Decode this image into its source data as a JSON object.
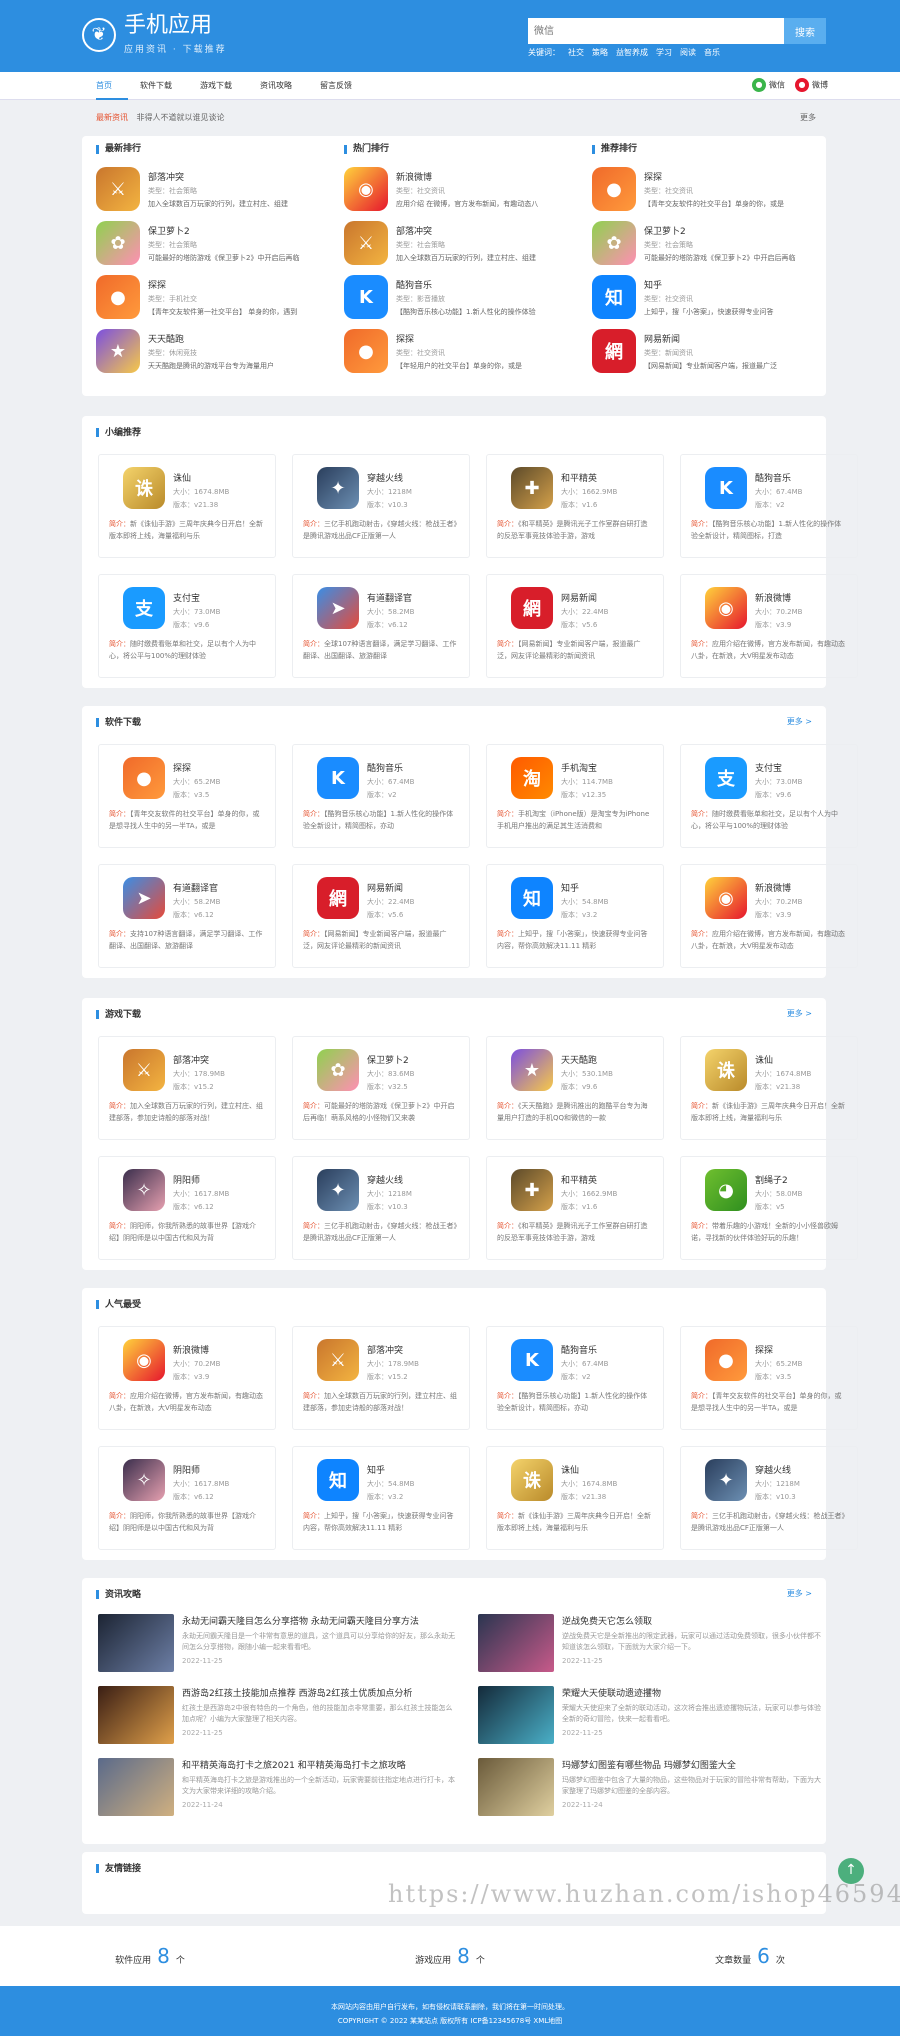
{
  "header": {
    "title": "手机应用",
    "subtitle": "应用资讯 · 下载推荐",
    "search_placeholder": "微信",
    "search_button": "搜索",
    "hot_label": "关键词：",
    "hot": [
      "社交",
      "策略",
      "益智养成",
      "学习",
      "阅读",
      "音乐"
    ]
  },
  "nav": {
    "items": [
      "首页",
      "软件下载",
      "游戏下载",
      "资讯攻略",
      "留言反馈"
    ],
    "wechat": "微信",
    "weibo": "微博"
  },
  "notice": {
    "label": "最新资讯",
    "text": "非得人不道就以谁见谈论",
    "more": "更多"
  },
  "rank": {
    "columns": [
      {
        "title": "最新排行",
        "items": [
          {
            "name": "部落冲突",
            "cat": "类型：社会策略",
            "desc": "加入全球数百万玩家的行列，建立村庄、组建"
          },
          {
            "name": "保卫萝卜2",
            "cat": "类型：社会策略",
            "desc": "可能最好的塔防游戏《保卫萝卜2》中开启后再临"
          },
          {
            "name": "探探",
            "cat": "类型：手机社交",
            "desc": "【青年交友软件第一社交平台】 单身的你，遇到"
          },
          {
            "name": "天天酷跑",
            "cat": "类型：休闲竞技",
            "desc": "天天酷跑是腾讯的游戏平台专为海量用户"
          }
        ]
      },
      {
        "title": "热门排行",
        "items": [
          {
            "name": "新浪微博",
            "cat": "类型：社交资讯",
            "desc": "应用介绍 在微博，官方发布新闻，有趣动态八"
          },
          {
            "name": "部落冲突",
            "cat": "类型：社会策略",
            "desc": "加入全球数百万玩家的行列，建立村庄、组建"
          },
          {
            "name": "酷狗音乐",
            "cat": "类型：影音播放",
            "desc": "【酷狗音乐核心功能】1.新人性化的操作体验"
          },
          {
            "name": "探探",
            "cat": "类型：社交资讯",
            "desc": "【年轻用户的社交平台】单身的你，或是"
          }
        ]
      },
      {
        "title": "推荐排行",
        "items": [
          {
            "name": "探探",
            "cat": "类型：社交资讯",
            "desc": "【青年交友软件的社交平台】单身的你，或是"
          },
          {
            "name": "保卫萝卜2",
            "cat": "类型：社会策略",
            "desc": "可能最好的塔防游戏《保卫萝卜2》中开启后再临"
          },
          {
            "name": "知乎",
            "cat": "类型：社交资讯",
            "desc": "上知乎，搜「小答案」，快速获得专业问答"
          },
          {
            "name": "网易新闻",
            "cat": "类型：新闻资讯",
            "desc": "【网易新闻】专业新闻客户端，报道最广泛"
          }
        ]
      }
    ]
  },
  "sections": [
    {
      "title": "小编推荐",
      "more": "",
      "cards": [
        {
          "name": "诛仙",
          "size": "大小：1674.8MB",
          "ver": "版本：v21.38",
          "desc": "新《诛仙手游》三周年庆典今日开启！全新版本即将上线，海量福利与乐"
        },
        {
          "name": "穿越火线",
          "size": "大小：1218M",
          "ver": "版本：v10.3",
          "desc": "三亿手机跑动射击，《穿越火线：枪战王者》是腾讯游戏出品CF正版第一人"
        },
        {
          "name": "和平精英",
          "size": "大小：1662.9MB",
          "ver": "版本：v1.6",
          "desc": "《和平精英》是腾讯光子工作室群自研打造的反恐军事竞技体验手游，游戏"
        },
        {
          "name": "酷狗音乐",
          "size": "大小：67.4MB",
          "ver": "版本：v2",
          "desc": "【酷狗音乐核心功能】1.新人性化的操作体验全新设计，精简图标，打造"
        },
        {
          "name": "支付宝",
          "size": "大小：73.0MB",
          "ver": "版本：v9.6",
          "desc": "随时缴费看账单和社交，足以有个人为中心，将公平与100%的理财体验"
        },
        {
          "name": "有道翻译官",
          "size": "大小：58.2MB",
          "ver": "版本：v6.12",
          "desc": "全球107种语言翻译，满足学习翻译、工作翻译、出国翻译、旅游翻译"
        },
        {
          "name": "网易新闻",
          "size": "大小：22.4MB",
          "ver": "版本：v5.6",
          "desc": "【网易新闻】专业新闻客户端，报道最广泛，网友评论最精彩的新闻资讯"
        },
        {
          "name": "新浪微博",
          "size": "大小：70.2MB",
          "ver": "版本：v3.9",
          "desc": "应用介绍在微博，官方发布新闻，有趣动态八卦，在新浪，大V明星发布动态"
        }
      ]
    },
    {
      "title": "软件下载",
      "more": "更多 >",
      "cards": [
        {
          "name": "探探",
          "size": "大小：65.2MB",
          "ver": "版本：v3.5",
          "desc": "【青年交友软件的社交平台】单身的你，或是想寻找人生中的另一半TA，或是"
        },
        {
          "name": "酷狗音乐",
          "size": "大小：67.4MB",
          "ver": "版本：v2",
          "desc": "【酷狗音乐核心功能】1.新人性化的操作体验全新设计，精简图标，亦动"
        },
        {
          "name": "手机淘宝",
          "size": "大小：114.7MB",
          "ver": "版本：v12.35",
          "desc": "手机淘宝（iPhone版）是淘宝专为iPhone手机用户推出的满足其生活消费和"
        },
        {
          "name": "支付宝",
          "size": "大小：73.0MB",
          "ver": "版本：v9.6",
          "desc": "随时缴费看账单和社交，足以有个人为中心，将公平与100%的理财体验"
        },
        {
          "name": "有道翻译官",
          "size": "大小：58.2MB",
          "ver": "版本：v6.12",
          "desc": "支持107种语言翻译，满足学习翻译、工作翻译、出国翻译、旅游翻译"
        },
        {
          "name": "网易新闻",
          "size": "大小：22.4MB",
          "ver": "版本：v5.6",
          "desc": "【网易新闻】专业新闻客户端，报道最广泛，网友评论最精彩的新闻资讯"
        },
        {
          "name": "知乎",
          "size": "大小：54.8MB",
          "ver": "版本：v3.2",
          "desc": "上知乎，搜「小答案」，快速获得专业问答内容，帮你高效解决11.11 精彩"
        },
        {
          "name": "新浪微博",
          "size": "大小：70.2MB",
          "ver": "版本：v3.9",
          "desc": "应用介绍在微博，官方发布新闻，有趣动态八卦，在新浪，大V明星发布动态"
        }
      ]
    },
    {
      "title": "游戏下载",
      "more": "更多 >",
      "cards": [
        {
          "name": "部落冲突",
          "size": "大小：178.9MB",
          "ver": "版本：v15.2",
          "desc": "加入全球数百万玩家的行列，建立村庄、组建部落，参加史诗般的部落对战！"
        },
        {
          "name": "保卫萝卜2",
          "size": "大小：83.6MB",
          "ver": "版本：v32.5",
          "desc": "可能最好的塔防游戏《保卫萝卜2》中开启后再临！萌系风格的小怪物们又来袭"
        },
        {
          "name": "天天酷跑",
          "size": "大小：530.1MB",
          "ver": "版本：v9.6",
          "desc": "《天天酷跑》是腾讯推出的跑酷平台专为海量用户打造的手机QQ和微信的一款"
        },
        {
          "name": "诛仙",
          "size": "大小：1674.8MB",
          "ver": "版本：v21.38",
          "desc": "新《诛仙手游》三周年庆典今日开启！全新版本即将上线，海量福利与乐"
        },
        {
          "name": "阴阳师",
          "size": "大小：1617.8MB",
          "ver": "版本：v6.12",
          "desc": "阴阳师，你我所熟悉的故事世界【游戏介绍】阴阳师是以中国古代和风为背"
        },
        {
          "name": "穿越火线",
          "size": "大小：1218M",
          "ver": "版本：v10.3",
          "desc": "三亿手机跑动射击，《穿越火线：枪战王者》是腾讯游戏出品CF正版第一人"
        },
        {
          "name": "和平精英",
          "size": "大小：1662.9MB",
          "ver": "版本：v1.6",
          "desc": "《和平精英》是腾讯光子工作室群自研打造的反恐军事竞技体验手游，游戏"
        },
        {
          "name": "割绳子2",
          "size": "大小：58.0MB",
          "ver": "版本：v5",
          "desc": "带着乐趣的小游戏！全新的小小怪兽欧姆诺，寻找新的伙伴体验好玩的乐趣！"
        }
      ]
    },
    {
      "title": "人气最受",
      "more": "",
      "cards": [
        {
          "name": "新浪微博",
          "size": "大小：70.2MB",
          "ver": "版本：v3.9",
          "desc": "应用介绍在微博，官方发布新闻，有趣动态八卦，在新浪，大V明星发布动态"
        },
        {
          "name": "部落冲突",
          "size": "大小：178.9MB",
          "ver": "版本：v15.2",
          "desc": "加入全球数百万玩家的行列，建立村庄、组建部落，参加史诗般的部落对战！"
        },
        {
          "name": "酷狗音乐",
          "size": "大小：67.4MB",
          "ver": "版本：v2",
          "desc": "【酷狗音乐核心功能】1.新人性化的操作体验全新设计，精简图标，亦动"
        },
        {
          "name": "探探",
          "size": "大小：65.2MB",
          "ver": "版本：v3.5",
          "desc": "【青年交友软件的社交平台】单身的你，或是想寻找人生中的另一半TA，或是"
        },
        {
          "name": "阴阳师",
          "size": "大小：1617.8MB",
          "ver": "版本：v6.12",
          "desc": "阴阳师，你我所熟悉的故事世界【游戏介绍】阴阳师是以中国古代和风为背"
        },
        {
          "name": "知乎",
          "size": "大小：54.8MB",
          "ver": "版本：v3.2",
          "desc": "上知乎，搜「小答案」，快速获得专业问答内容，帮你高效解决11.11 精彩"
        },
        {
          "name": "诛仙",
          "size": "大小：1674.8MB",
          "ver": "版本：v21.38",
          "desc": "新《诛仙手游》三周年庆典今日开启！全新版本即将上线，海量福利与乐"
        },
        {
          "name": "穿越火线",
          "size": "大小：1218M",
          "ver": "版本：v10.3",
          "desc": "三亿手机跑动射击，《穿越火线：枪战王者》是腾讯游戏出品CF正版第一人"
        }
      ]
    }
  ],
  "card_desc_label": "简介：",
  "news": {
    "title": "资讯攻略",
    "more": "更多 >",
    "items": [
      {
        "title": "永劫无间霸天隆目怎么分享搭物 永劫无间霸天隆目分享方法",
        "summary": "永劫无间霸天隆目是一个非常有意思的道具，这个道具可以分享给你的好友，那么永劫无间怎么分享搭物，跟随小编一起来看看吧。",
        "date": "2022-11-25"
      },
      {
        "title": "逆战免费天它怎么领取",
        "summary": "逆战免费天它是全新推出的限定武器，玩家可以通过活动免费领取，很多小伙伴都不知道该怎么领取，下面就为大家介绍一下。",
        "date": "2022-11-25"
      },
      {
        "title": "西游岛2红孩土技能加点推荐 西游岛2红孩土优质加点分析",
        "summary": "红孩土是西游岛2中很有特色的一个角色，他的技能加点非常重要，那么红孩土技能怎么加点呢？小编为大家整理了相关内容。",
        "date": "2022-11-25"
      },
      {
        "title": "荣耀大天使联动遗迹攫物",
        "summary": "荣耀大天使迎来了全新的联动活动，这次将会推出遗迹攫物玩法，玩家可以参与体验全新的奇幻冒险，快来一起看看吧。",
        "date": "2022-11-25"
      },
      {
        "title": "和平精英海岛打卡之旅2021 和平精英海岛打卡之旅攻略",
        "summary": "和平精英海岛打卡之旅是游戏推出的一个全新活动，玩家需要前往指定地点进行打卡，本文为大家带来详细的攻略介绍。",
        "date": "2022-11-24"
      },
      {
        "title": "玛娜梦幻图鉴有哪些物品 玛娜梦幻图鉴大全",
        "summary": "玛娜梦幻图鉴中包含了大量的物品，这些物品对于玩家的冒险非常有帮助，下面为大家整理了玛娜梦幻图鉴的全部内容。",
        "date": "2022-11-24"
      }
    ]
  },
  "links": {
    "title": "友情链接"
  },
  "stats": [
    {
      "label": "软件应用",
      "num": "8",
      "unit": "个"
    },
    {
      "label": "游戏应用",
      "num": "8",
      "unit": "个"
    },
    {
      "label": "文章数量",
      "num": "6",
      "unit": "次"
    }
  ],
  "footer": {
    "line1": "本网站内容由用户自行发布，如有侵权请联系删除，我们将在第一时间处理。",
    "line2": "COPYRIGHT © 2022 某某站点 版权所有 ICP备12345678号 XML地图"
  },
  "watermark": "https://www.huzhan.com/ishop46594",
  "colors": {
    "brand": "#2d8ee0",
    "accent": "#e5502d"
  }
}
